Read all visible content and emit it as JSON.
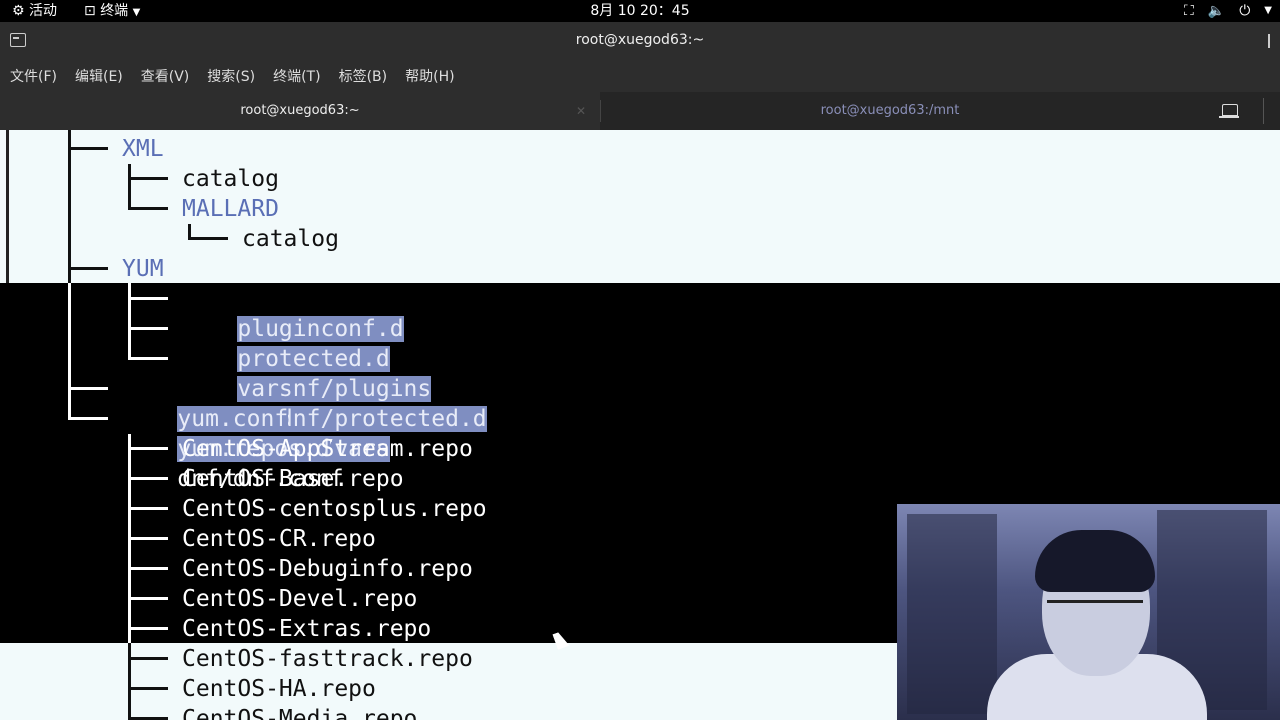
{
  "topbar": {
    "activities": "活动",
    "app_menu": "终端",
    "clock": "8月 10 20：45"
  },
  "window": {
    "title": "root@xuegod63:~"
  },
  "menu": [
    "文件(F)",
    "编辑(E)",
    "查看(V)",
    "搜索(S)",
    "终端(T)",
    "标签(B)",
    "帮助(H)"
  ],
  "tabs": [
    {
      "label": "root@xuegod63:~",
      "active": true
    },
    {
      "label": "root@xuegod63:/mnt",
      "active": false
    }
  ],
  "terminal": {
    "lines": [
      {
        "name": "XML"
      },
      {
        "name": "catalog"
      },
      {
        "name": "MALLARD"
      },
      {
        "name": "catalog"
      },
      {
        "name": "YUM"
      },
      {
        "name": "pluginconf.d",
        "arrow": "->",
        "target": "../dnf/plugins"
      },
      {
        "name": "protected.d",
        "arrow": "->",
        "target": "../dnf/protected.d"
      },
      {
        "name": "vars",
        "arrow": "->",
        "target": "../dnf/vars"
      },
      {
        "name": "yum.conf",
        "arrow": "->",
        "target": "dnf/dnf.conf"
      },
      {
        "name": "yum.repos.d"
      },
      {
        "name": "CentOS-AppStream.repo"
      },
      {
        "name": "CentOS-Base.repo"
      },
      {
        "name": "CentOS-centosplus.repo"
      },
      {
        "name": "CentOS-CR.repo"
      },
      {
        "name": "CentOS-Debuginfo.repo"
      },
      {
        "name": "CentOS-Devel.repo"
      },
      {
        "name": "CentOS-Extras.repo"
      },
      {
        "name": "CentOS-fasttrack.repo"
      },
      {
        "name": "CentOS-HA.repo"
      },
      {
        "name": "CentOS-Media.repo"
      }
    ]
  },
  "icons": [
    "activities-icon",
    "terminal-icon",
    "network-icon",
    "volume-icon",
    "power-icon",
    "new-tab-icon"
  ],
  "colors": {
    "highlight": "#7f8ec1",
    "light_bg": "#f2fafb",
    "dir_blue": "#5a6fb5"
  }
}
